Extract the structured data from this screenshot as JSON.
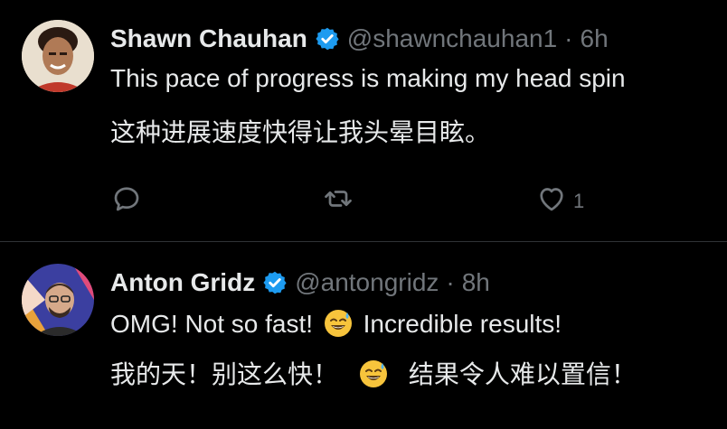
{
  "tweets": [
    {
      "author_name": "Shawn Chauhan",
      "handle": "@shawnchauhan1",
      "separator": "·",
      "time": "6h",
      "text_en": "This pace of progress is making my head spin",
      "text_zh": "这种进展速度快得让我头晕目眩。",
      "actions": {
        "reply_icon": "reply-icon",
        "retweet_icon": "retweet-icon",
        "like_icon": "heart-icon",
        "like_count": "1"
      }
    },
    {
      "author_name": "Anton Gridz",
      "handle": "@antongridz",
      "separator": "·",
      "time": "8h",
      "text_en_before": "OMG! Not so fast!",
      "text_en_after": "Incredible results!",
      "text_zh_before": "我的天！别这么快！",
      "text_zh_after": "结果令人难以置信！",
      "emoji": "grinning-face-with-sweat-emoji"
    }
  ],
  "colors": {
    "background": "#000000",
    "text_primary": "#e7e9ea",
    "text_secondary": "#71767b",
    "verified_blue": "#1d9bf0",
    "divider": "#2f3336"
  }
}
